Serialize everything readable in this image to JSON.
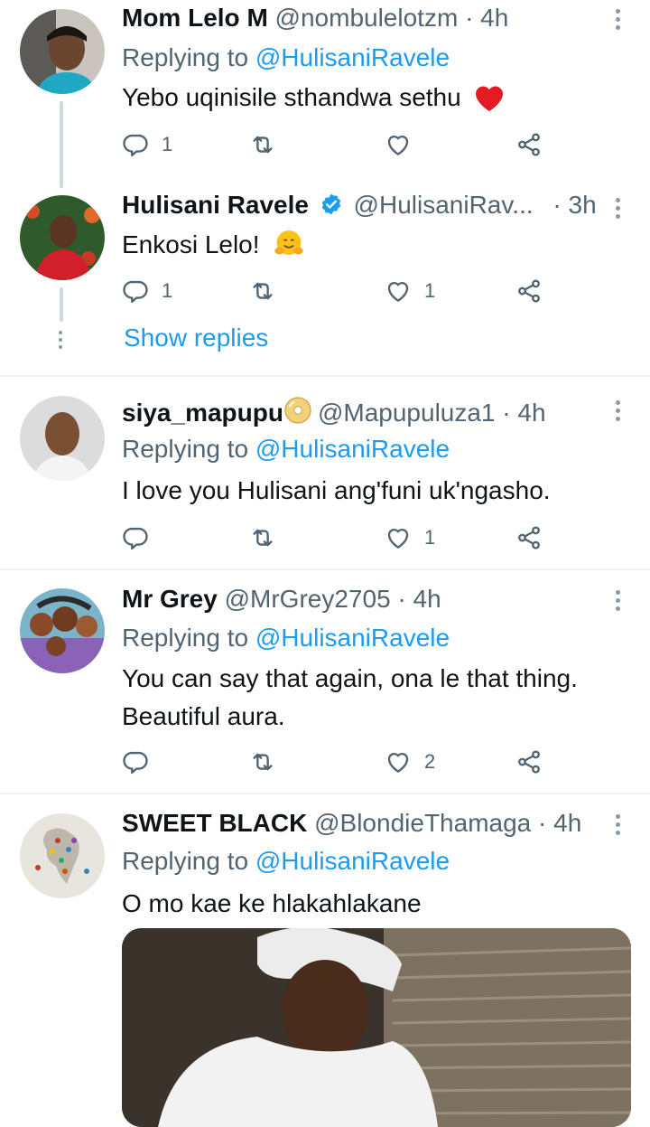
{
  "tweets": [
    {
      "name": "Mom Lelo M",
      "handle": "@nombulelotzm",
      "dot": "·",
      "time": "4h",
      "replying_prefix": "Replying to",
      "replying_to": "@HulisaniRavele",
      "text": "Yebo uqinisile sthandwa sethu",
      "emoji": "❤️",
      "replies": "1",
      "retweets": "",
      "likes": ""
    },
    {
      "name": "Hulisani Ravele",
      "verified": true,
      "handle": "@HulisaniRav...",
      "dot": "·",
      "time": "3h",
      "text": "Enkosi Lelo!",
      "emoji": "🤗",
      "replies": "1",
      "retweets": "",
      "likes": "1",
      "show_replies": "Show replies"
    },
    {
      "name": "siya_mapupu",
      "name_emoji": "📀",
      "handle": "@Mapupuluza1",
      "dot": "·",
      "time": "4h",
      "replying_prefix": "Replying to",
      "replying_to": "@HulisaniRavele",
      "text": "I love you Hulisani ang'funi uk'ngasho.",
      "replies": "",
      "retweets": "",
      "likes": "1"
    },
    {
      "name": "Mr Grey",
      "handle": "@MrGrey2705",
      "dot": "·",
      "time": "4h",
      "replying_prefix": "Replying to",
      "replying_to": "@HulisaniRavele",
      "text": "You can say that again, ona le that thing. Beautiful aura.",
      "replies": "",
      "retweets": "",
      "likes": "2"
    },
    {
      "name": "SWEET BLACK",
      "handle": "@BlondieThamaga",
      "dot": "·",
      "time": "4h",
      "replying_prefix": "Replying to",
      "replying_to": "@HulisaniRavele",
      "text": "O mo kae ke hlakahlakane"
    }
  ],
  "icons": {
    "reply": "reply-icon",
    "retweet": "retweet-icon",
    "like": "heart-icon",
    "share": "share-icon",
    "more": "more-icon",
    "verified": "verified-badge-icon"
  },
  "colors": {
    "accent": "#1d9bf0",
    "secondary_text": "#536471",
    "divider": "#eff3f4",
    "heart": "#e0245e"
  }
}
